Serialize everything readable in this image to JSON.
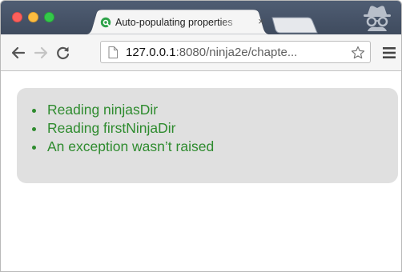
{
  "browser": {
    "tab": {
      "title": "Auto-populating properties",
      "close_label": "×"
    },
    "address_bar": {
      "host": "127.0.0.1",
      "path": ":8080/ninja2e/chapte..."
    }
  },
  "page": {
    "results": [
      {
        "text": "Reading ninjasDir"
      },
      {
        "text": "Reading firstNinjaDir"
      },
      {
        "text": "An exception wasn’t raised"
      }
    ]
  },
  "colors": {
    "pass_text": "#2e8b2e",
    "results_background": "#e0e0e0",
    "titlebar": "#4a576b"
  },
  "icons": {
    "favicon": "qunit-favicon-icon",
    "page": "page-icon",
    "bookmark": "star-icon",
    "menu": "hamburger-menu-icon",
    "incognito": "incognito-icon"
  }
}
